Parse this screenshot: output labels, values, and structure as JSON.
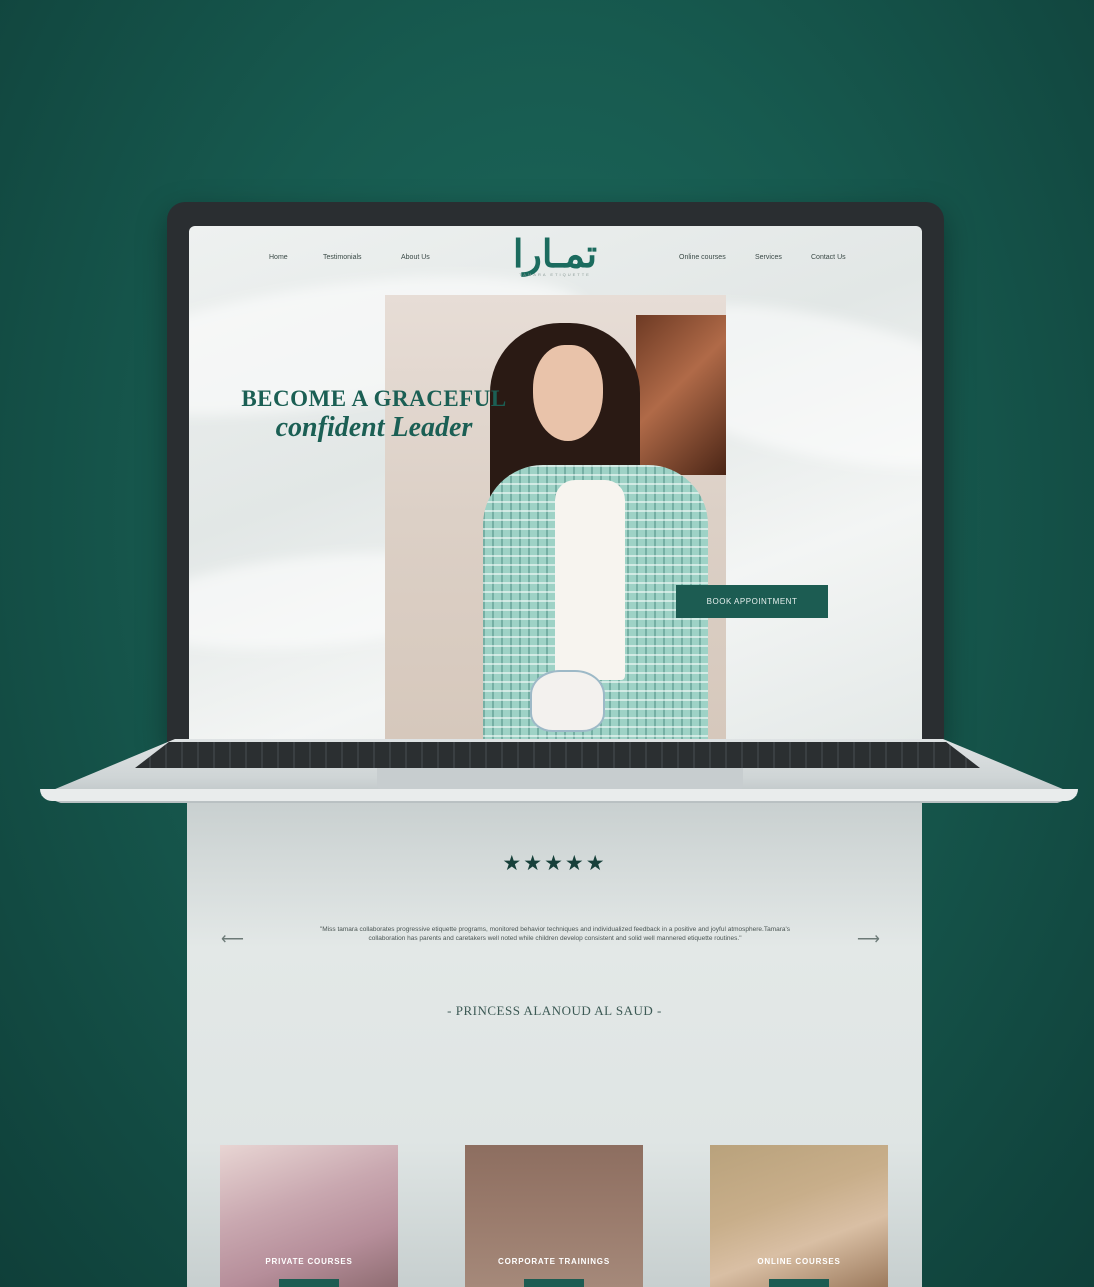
{
  "nav": {
    "left": [
      "Home",
      "Testimonials",
      "About Us"
    ],
    "right": [
      "Online courses",
      "Services",
      "Contact Us"
    ]
  },
  "logo": {
    "arabic": "تمـارا",
    "subtitle": "TAMARA ETIQUETTE"
  },
  "hero": {
    "line1": "BECOME A GRACEFUL",
    "line2": "confident Leader",
    "cta": "BOOK APPOINTMENT"
  },
  "testimonial": {
    "rating": "★★★★★",
    "prev_arrow": "⟵",
    "next_arrow": "⟶",
    "quote": "\"Miss tamara collaborates progressive etiquette programs, monitored behavior techniques and individualized feedback in a positive and joyful atmosphere.Tamara's collaboration has parents and caretakers well noted while children develop consistent and solid well mannered etiquette routines.\"",
    "author": "- PRINCESS ALANOUD AL SAUD -"
  },
  "courses": [
    {
      "label": "PRIVATE COURSES"
    },
    {
      "label": "CORPORATE TRAININGS"
    },
    {
      "label": "ONLINE COURSES"
    }
  ],
  "colors": {
    "brand_green": "#1b6b5e",
    "button_green": "#1c5c52",
    "background": "#175a4f"
  }
}
